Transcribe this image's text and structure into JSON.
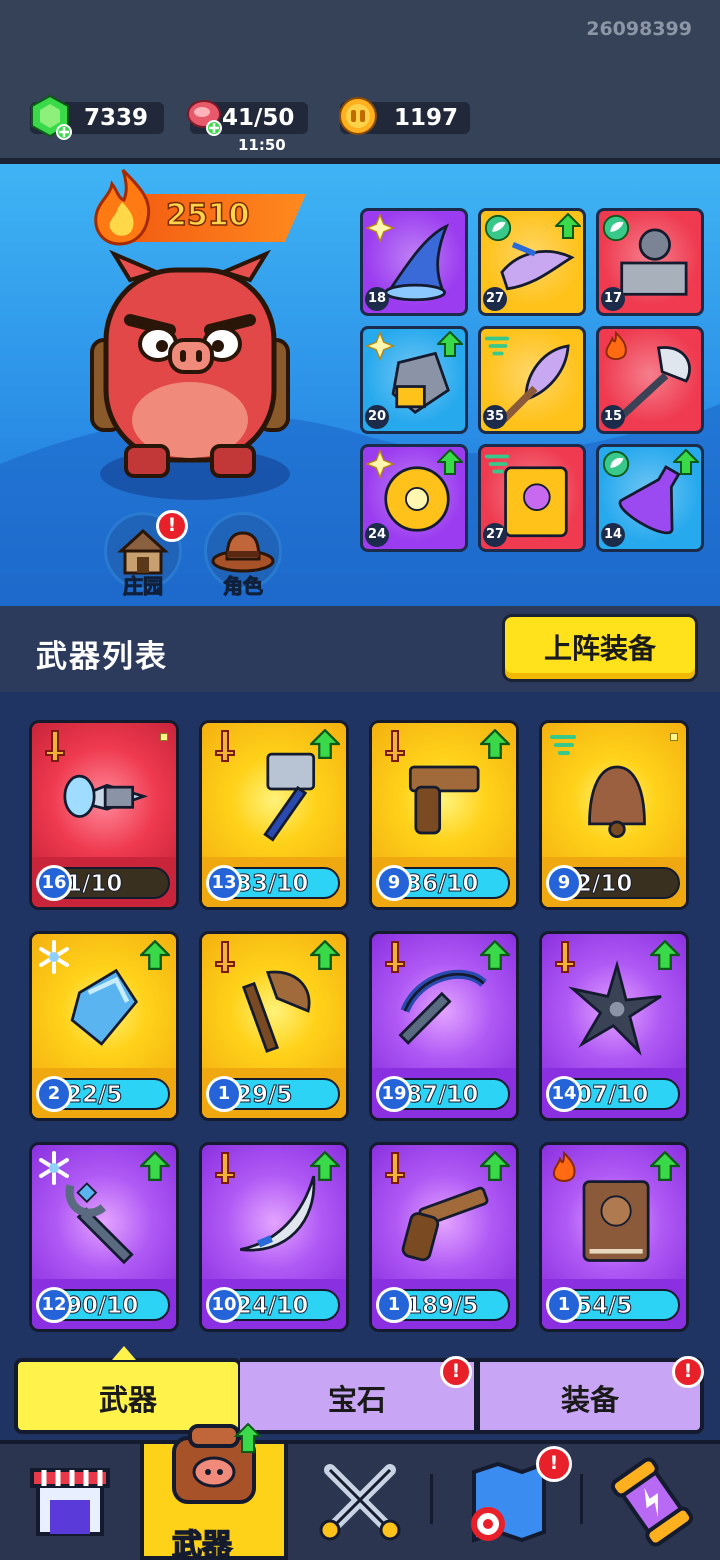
{
  "player_id": "26098399",
  "resources": {
    "gems": "7339",
    "stamina": "41/50",
    "stamina_timer": "11:50",
    "coins": "1197"
  },
  "hero": {
    "power": "2510",
    "buttons": [
      {
        "label": "庄园",
        "badge": "!"
      },
      {
        "label": "角色"
      }
    ],
    "equipped_slots": [
      {
        "level": "18",
        "color": "purple",
        "icon": "wizard-hat-icon",
        "element": "star"
      },
      {
        "level": "27",
        "color": "gold",
        "icon": "bird-icon",
        "element": "leaf",
        "upgrade": true
      },
      {
        "level": "17",
        "color": "red",
        "icon": "statue-icon",
        "element": "leaf"
      },
      {
        "level": "20",
        "color": "blue",
        "icon": "glove-icon",
        "element": "star",
        "upgrade": true
      },
      {
        "level": "35",
        "color": "gold",
        "icon": "feather-staff-icon",
        "element": "wind"
      },
      {
        "level": "15",
        "color": "red",
        "icon": "spear-icon",
        "element": "fire"
      },
      {
        "level": "24",
        "color": "purple",
        "icon": "ring-icon",
        "element": "star",
        "upgrade": true
      },
      {
        "level": "27",
        "color": "red",
        "icon": "spellbook-icon",
        "element": "wind"
      },
      {
        "level": "14",
        "color": "blue",
        "icon": "potion-icon",
        "element": "leaf",
        "upgrade": true
      }
    ]
  },
  "list": {
    "title": "武器列表",
    "deploy_button": "上阵装备"
  },
  "weapons": [
    {
      "level": "16",
      "progress": "1/10",
      "color": "red",
      "icon": "drill-icon",
      "tag": "sword",
      "upgrade": false,
      "bar": "dark"
    },
    {
      "level": "13",
      "progress": "33/10",
      "color": "gold",
      "icon": "hammer-icon",
      "tag": "sword",
      "upgrade": true
    },
    {
      "level": "9",
      "progress": "36/10",
      "color": "gold",
      "icon": "pistol-icon",
      "tag": "sword",
      "upgrade": true
    },
    {
      "level": "9",
      "progress": "2/10",
      "color": "gold",
      "icon": "bell-icon",
      "tag": "wind",
      "upgrade": false,
      "bar": "dark"
    },
    {
      "level": "2",
      "progress": "22/5",
      "color": "gold",
      "icon": "crystal-icon",
      "tag": "snow",
      "upgrade": true
    },
    {
      "level": "1",
      "progress": "29/5",
      "color": "gold",
      "icon": "axe-icon",
      "tag": "sword",
      "upgrade": true
    },
    {
      "level": "19",
      "progress": "87/10",
      "color": "purple",
      "icon": "crossbow-icon",
      "tag": "sword",
      "upgrade": true
    },
    {
      "level": "14",
      "progress": "07/10",
      "color": "purple",
      "icon": "shuriken-icon",
      "tag": "sword",
      "upgrade": true
    },
    {
      "level": "12",
      "progress": "90/10",
      "color": "purple",
      "icon": "ice-staff-icon",
      "tag": "snow",
      "upgrade": true
    },
    {
      "level": "10",
      "progress": "24/10",
      "color": "purple",
      "icon": "boomerang-icon",
      "tag": "sword",
      "upgrade": true
    },
    {
      "level": "1",
      "progress": "189/5",
      "color": "purple",
      "icon": "revolver-icon",
      "tag": "sword",
      "upgrade": true
    },
    {
      "level": "1",
      "progress": "54/5",
      "color": "purple",
      "icon": "tome-icon",
      "tag": "fire",
      "upgrade": true
    }
  ],
  "tabs": [
    {
      "label": "武器",
      "active": true
    },
    {
      "label": "宝石",
      "badge": "!"
    },
    {
      "label": "装备",
      "badge": "!"
    }
  ],
  "nav": {
    "active_label": "武器",
    "badge": "!",
    "items": [
      "shop-icon",
      "weapon-bag-icon",
      "crossed-swords-icon",
      "map-icon",
      "capsule-icon"
    ]
  },
  "colors": {
    "gold": "#ffc21a",
    "purple": "#9b3cf0",
    "red": "#ef3a4f",
    "blue": "#27a9ee"
  }
}
